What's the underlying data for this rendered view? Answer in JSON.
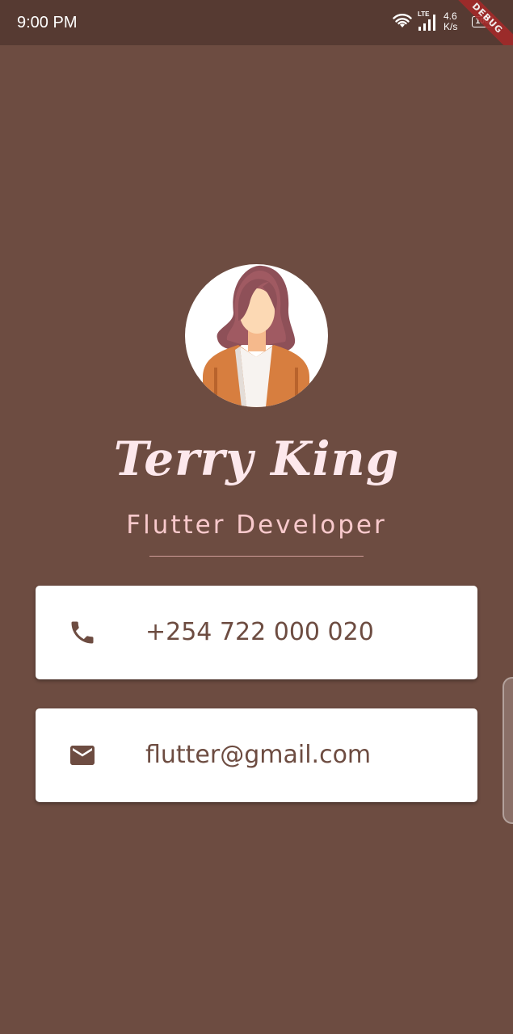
{
  "status_bar": {
    "time": "9:00 PM",
    "network_label": "LTE",
    "speed_value": "4.6",
    "speed_unit": "K/s",
    "battery": "100"
  },
  "debug_banner": "DEBUG",
  "profile": {
    "name": "Terry King",
    "title": "Flutter Developer"
  },
  "contacts": {
    "phone": "+254 722 000 020",
    "email": "flutter@gmail.com"
  },
  "colors": {
    "background": "#6d4c41",
    "status_bar": "#563a32",
    "name_text": "#fde8ec",
    "title_text": "#f8c9cc",
    "card": "#ffffff",
    "card_content": "#6d4c41"
  },
  "icons": {
    "phone": "phone-icon",
    "email": "mail-icon",
    "wifi": "wifi-icon",
    "signal": "signal-icon",
    "battery": "battery-icon"
  }
}
